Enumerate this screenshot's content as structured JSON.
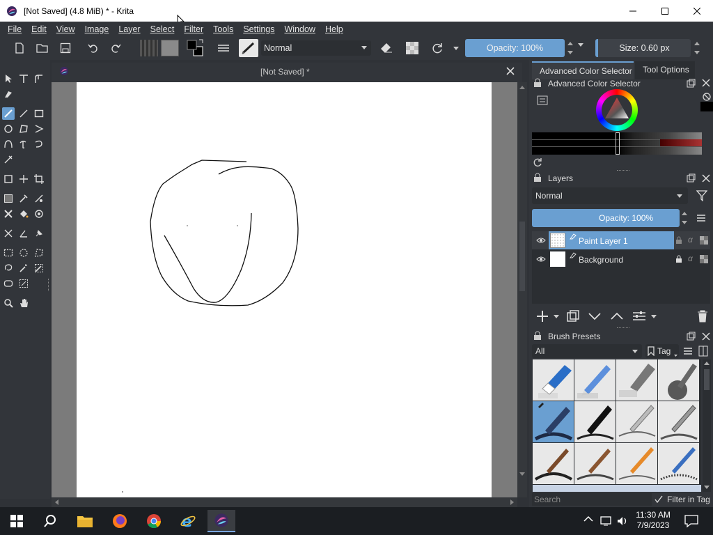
{
  "window": {
    "title": "[Not Saved]  (4.8 MiB)  * - Krita"
  },
  "menu": [
    "File",
    "Edit",
    "View",
    "Image",
    "Layer",
    "Select",
    "Filter",
    "Tools",
    "Settings",
    "Window",
    "Help"
  ],
  "toolbar": {
    "blend_mode": "Normal",
    "opacity_label": "Opacity: 100%",
    "size_label": "Size: 0.60 px"
  },
  "document": {
    "tab_title": "[Not Saved]  *"
  },
  "dock": {
    "tabs": [
      "Advanced Color Selector",
      "Tool Options"
    ],
    "color_selector_title": "Advanced Color Selector",
    "layers_title": "Layers",
    "layers_blend": "Normal",
    "layers_opacity": "Opacity:  100%",
    "layers": [
      {
        "name": "Paint Layer 1",
        "selected": true
      },
      {
        "name": "Background",
        "selected": false
      }
    ],
    "brush_presets_title": "Brush Presets",
    "brush_filter": "All",
    "tag_label": "Tag",
    "search_placeholder": "Search",
    "filter_in_tag": "Filter in Tag"
  },
  "taskbar": {
    "time": "11:30 AM",
    "date": "7/9/2023"
  },
  "colors": {
    "selection_blue": "#6a9fd1",
    "panel_bg": "#32353a"
  }
}
